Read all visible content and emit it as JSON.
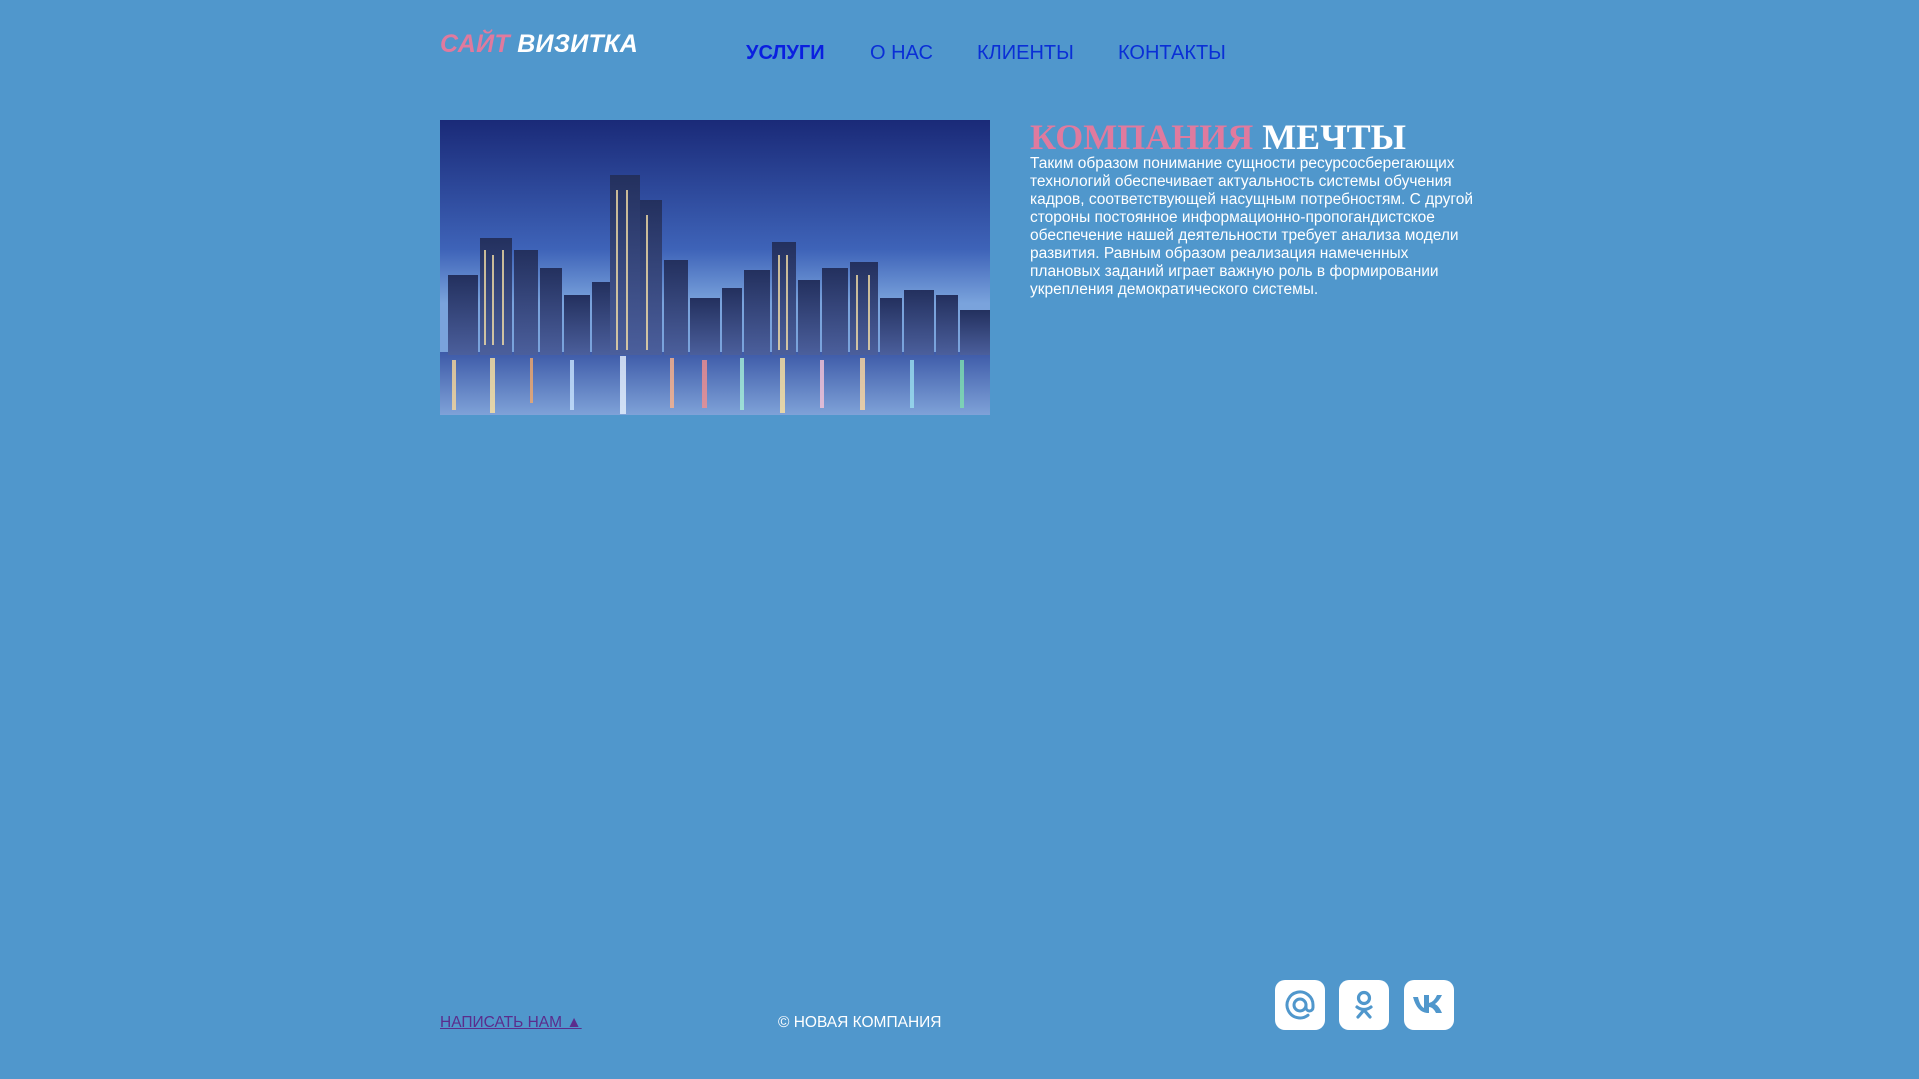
{
  "header": {
    "logo_part1": "САЙТ",
    "logo_part2": "ВИЗИТКА",
    "nav": [
      {
        "label": "УСЛУГИ",
        "active": true
      },
      {
        "label": "О НАС",
        "active": false
      },
      {
        "label": "КЛИЕНТЫ",
        "active": false
      },
      {
        "label": "КОНТАКТЫ",
        "active": false
      }
    ]
  },
  "main": {
    "heading_part1": "КОМПАНИЯ",
    "heading_part2": "МЕЧТЫ",
    "description": "Таким образом понимание сущности ресурсосберегающих технологий обеспечивает актуальность системы обучения кадров, соответствующей насущным потребностям. С другой стороны постоянное информационно-пропогандистское обеспечение нашей деятельности требует анализа модели развития. Равным образом реализация намеченных плановых заданий играет важную роль в формировании укрепления демократического системы."
  },
  "footer": {
    "write_us": "НАПИСАТЬ НАМ ▲",
    "copyright": "© НОВАЯ КОМПАНИЯ",
    "social": [
      {
        "icon": "mail-icon"
      },
      {
        "icon": "odnoklassniki-icon"
      },
      {
        "icon": "vk-icon"
      }
    ]
  },
  "colors": {
    "background": "#5097cc",
    "accent_pink": "#e07a9e",
    "nav_blue": "#0a2fd6",
    "white": "#ffffff",
    "link_purple": "#5b2d8c"
  }
}
